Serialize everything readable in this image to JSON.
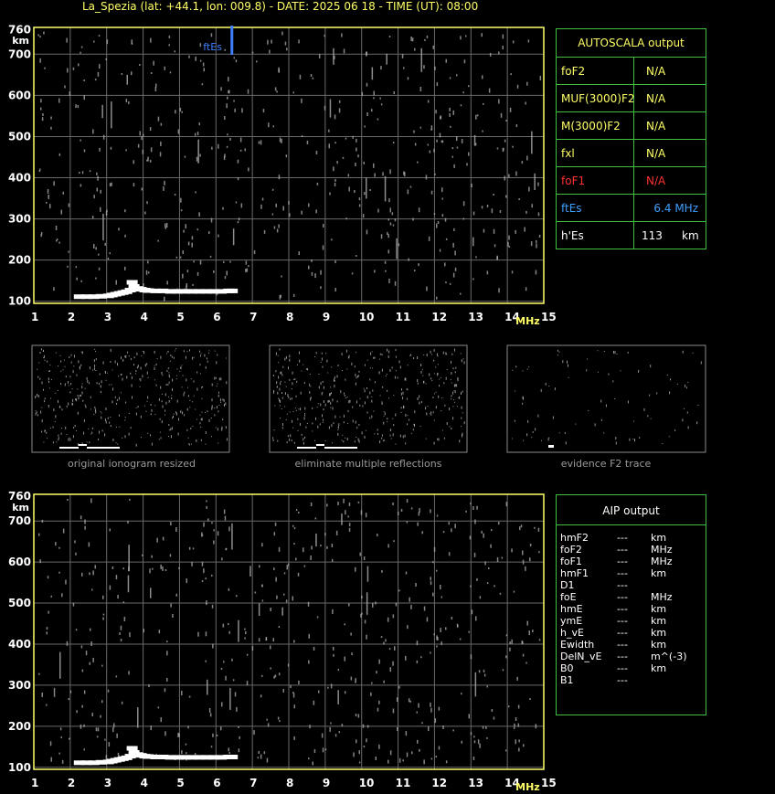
{
  "header": {
    "title": "La_Spezia (lat: +44.1, lon: 009.8) - DATE: 2025 06 18 - TIME (UT): 08:00"
  },
  "colors": {
    "axis": "#ffff66",
    "grid": "#6a6a6a",
    "trace": "#ffffff",
    "noise": "#b0b0b0",
    "ftes": "#3f7fff",
    "panel_border": "#3fbf3f",
    "red": "#ff3030",
    "blue": "#3f9fff"
  },
  "chart_data": [
    {
      "type": "scatter",
      "name": "main-ionogram",
      "title": "",
      "xlabel": "MHz",
      "ylabel": "km",
      "xlim": [
        1,
        15
      ],
      "ylim": [
        95,
        765
      ],
      "x_ticks": [
        "1",
        "2",
        "3",
        "4",
        "5",
        "6",
        "7",
        "8",
        "9",
        "10",
        "11",
        "12",
        "13",
        "14",
        "15"
      ],
      "y_ticks": [
        "100",
        "200",
        "300",
        "400",
        "500",
        "600",
        "700",
        "760"
      ],
      "grid": true,
      "annotation": {
        "label": "ftEs",
        "x": 6.4
      },
      "trace": {
        "x": [
          2.1,
          2.3,
          2.5,
          2.7,
          2.9,
          3.0,
          3.1,
          3.2,
          3.3,
          3.4,
          3.5,
          3.55,
          3.6,
          3.7,
          3.8,
          3.9,
          4.0,
          4.2,
          4.4,
          4.6,
          4.8,
          5.0,
          5.2,
          5.4,
          5.6,
          5.8,
          6.0,
          6.2,
          6.3
        ],
        "y": [
          110,
          110,
          110,
          111,
          112,
          114,
          116,
          118,
          120,
          122,
          126,
          145,
          135,
          130,
          128,
          126,
          125,
          124,
          124,
          123,
          123,
          123,
          123,
          123,
          123,
          123,
          123,
          124,
          124
        ]
      }
    },
    {
      "type": "scatter",
      "name": "aip-ionogram",
      "title": "",
      "xlabel": "MHz",
      "ylabel": "km",
      "xlim": [
        1,
        15
      ],
      "ylim": [
        95,
        765
      ],
      "x_ticks": [
        "1",
        "2",
        "3",
        "4",
        "5",
        "6",
        "7",
        "8",
        "9",
        "10",
        "11",
        "12",
        "13",
        "14",
        "15"
      ],
      "y_ticks": [
        "100",
        "200",
        "300",
        "400",
        "500",
        "600",
        "700",
        "760"
      ],
      "grid": true,
      "trace": {
        "x": [
          2.1,
          2.3,
          2.5,
          2.7,
          2.9,
          3.0,
          3.1,
          3.2,
          3.3,
          3.4,
          3.5,
          3.55,
          3.6,
          3.7,
          3.8,
          3.9,
          4.0,
          4.2,
          4.4,
          4.6,
          4.8,
          5.0,
          5.2,
          5.4,
          5.6,
          5.8,
          6.0,
          6.2,
          6.3
        ],
        "y": [
          110,
          110,
          110,
          111,
          112,
          114,
          116,
          118,
          120,
          122,
          126,
          145,
          135,
          130,
          128,
          126,
          125,
          124,
          124,
          123,
          123,
          123,
          123,
          123,
          123,
          123,
          123,
          124,
          124
        ]
      }
    }
  ],
  "thumbnails": [
    {
      "caption": "original ionogram resized"
    },
    {
      "caption": "eliminate multiple reflections"
    },
    {
      "caption": "evidence F2 trace"
    }
  ],
  "autoscala": {
    "title": "AUTOSCALA output",
    "rows": [
      {
        "label": "foF2",
        "value": "N/A",
        "unit": "",
        "color": "#ffff66"
      },
      {
        "label": "MUF(3000)F2",
        "value": "N/A",
        "unit": "",
        "color": "#ffff66"
      },
      {
        "label": "M(3000)F2",
        "value": "N/A",
        "unit": "",
        "color": "#ffff66"
      },
      {
        "label": "fxl",
        "value": "N/A",
        "unit": "",
        "color": "#ffff66"
      },
      {
        "label": "foF1",
        "value": "N/A",
        "unit": "",
        "color": "#ff3030"
      },
      {
        "label": "ftEs",
        "value": "6.4 MHz",
        "unit": "",
        "color": "#3f9fff"
      },
      {
        "label": "h'Es",
        "value": "113",
        "unit": "km",
        "color": "#ffffff"
      }
    ]
  },
  "aip": {
    "title": "AIP output",
    "rows": [
      {
        "label": "hmF2",
        "value": "---",
        "unit": "km"
      },
      {
        "label": "foF2",
        "value": "---",
        "unit": "MHz"
      },
      {
        "label": "foF1",
        "value": "---",
        "unit": "MHz"
      },
      {
        "label": "hmF1",
        "value": "---",
        "unit": "km"
      },
      {
        "label": "D1",
        "value": "---",
        "unit": ""
      },
      {
        "label": "foE",
        "value": "---",
        "unit": "MHz"
      },
      {
        "label": "hmE",
        "value": "---",
        "unit": "km"
      },
      {
        "label": "ymE",
        "value": "---",
        "unit": "km"
      },
      {
        "label": "h_vE",
        "value": "---",
        "unit": "km"
      },
      {
        "label": "Ewidth",
        "value": "---",
        "unit": "km"
      },
      {
        "label": "DelN_vE",
        "value": "---",
        "unit": "m^(-3)"
      },
      {
        "label": "B0",
        "value": "---",
        "unit": "km"
      },
      {
        "label": "B1",
        "value": "---",
        "unit": ""
      }
    ]
  }
}
